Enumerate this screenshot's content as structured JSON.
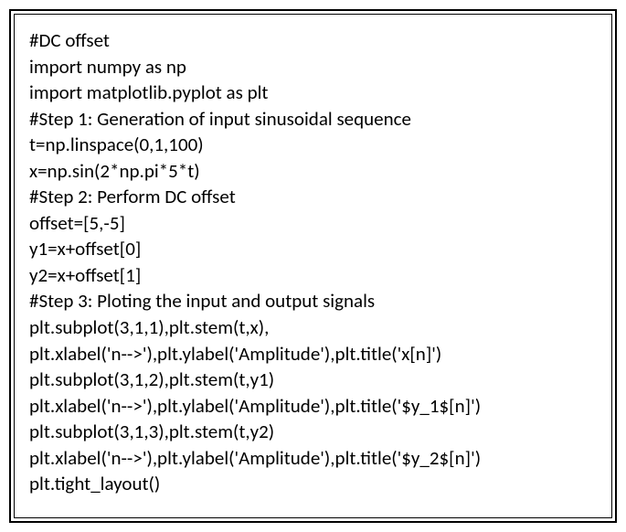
{
  "code": {
    "lines": [
      "#DC offset",
      "import numpy as np",
      "import matplotlib.pyplot as plt",
      "#Step 1: Generation of input sinusoidal sequence",
      "t=np.linspace(0,1,100)",
      "x=np.sin(2*np.pi*5*t)",
      "#Step 2: Perform DC offset",
      "offset=[5,-5]",
      "y1=x+offset[0]",
      "y2=x+offset[1]",
      "#Step 3: Ploting the input and output signals",
      "plt.subplot(3,1,1),plt.stem(t,x),",
      "plt.xlabel('n-->'),plt.ylabel('Amplitude'),plt.title('x[n]')",
      "plt.subplot(3,1,2),plt.stem(t,y1)",
      "plt.xlabel('n-->'),plt.ylabel('Amplitude'),plt.title('$y_1$[n]')",
      "plt.subplot(3,1,3),plt.stem(t,y2)",
      "plt.xlabel('n-->'),plt.ylabel('Amplitude'),plt.title('$y_2$[n]')",
      "plt.tight_layout()"
    ]
  }
}
